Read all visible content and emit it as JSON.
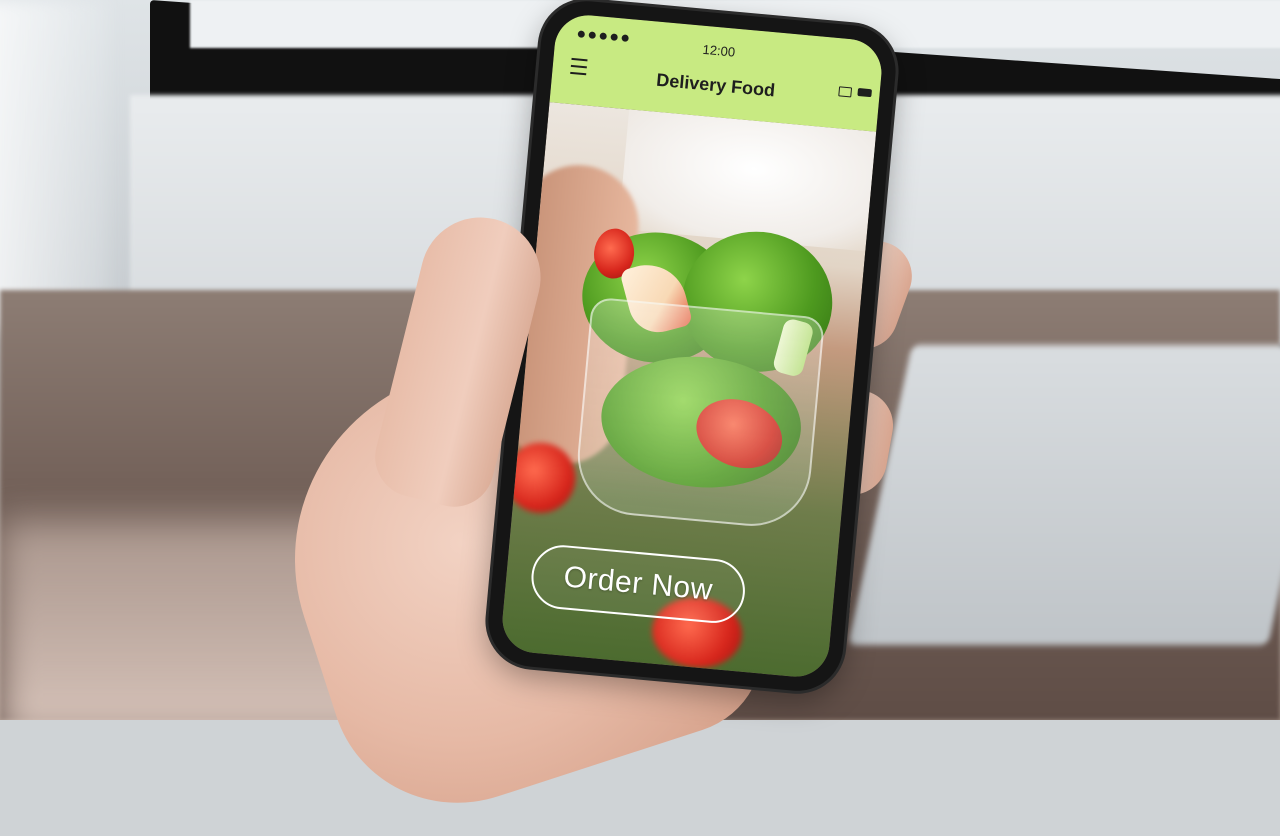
{
  "app": {
    "title": "Delivery Food",
    "time": "12:00",
    "order_button_label": "Order Now",
    "accent_color": "#c8ea82"
  },
  "icons": {
    "menu": "hamburger-menu-icon",
    "signal": "signal-dots-icon",
    "mail": "mail-icon",
    "battery": "battery-icon"
  }
}
